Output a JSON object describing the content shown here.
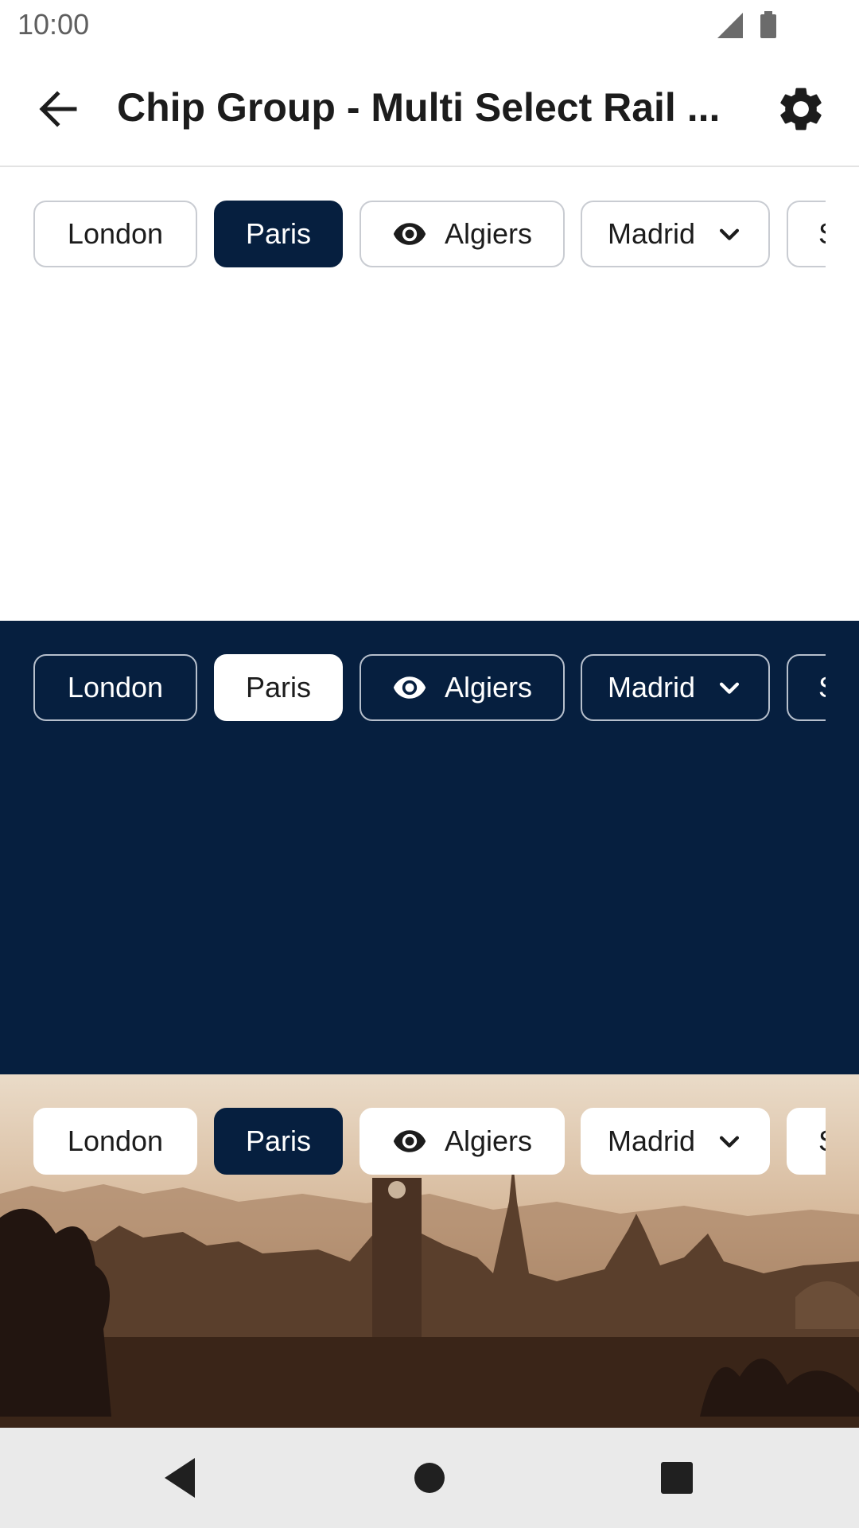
{
  "status_bar": {
    "time": "10:00",
    "icons": [
      "signal-icon",
      "battery-icon"
    ]
  },
  "app_bar": {
    "title": "Chip Group - Multi Select Rail ...",
    "back_icon": "arrow-back-icon",
    "settings_icon": "gear-icon"
  },
  "colors": {
    "brand_navy": "#061f3f",
    "chip_border": "#c9ccd2",
    "surface": "#ffffff",
    "nav_bar": "#e9e9e9"
  },
  "sections": [
    {
      "theme": "light",
      "chips": [
        {
          "label": "London",
          "selected": false
        },
        {
          "label": "Paris",
          "selected": true
        },
        {
          "label": "Algiers",
          "selected": false,
          "icon": "eye-icon"
        },
        {
          "label": "Madrid",
          "selected": false,
          "icon": "chevron-down-icon"
        },
        {
          "label": "S",
          "selected": false
        }
      ]
    },
    {
      "theme": "dark",
      "chips": [
        {
          "label": "London",
          "selected": false
        },
        {
          "label": "Paris",
          "selected": true
        },
        {
          "label": "Algiers",
          "selected": false,
          "icon": "eye-icon"
        },
        {
          "label": "Madrid",
          "selected": false,
          "icon": "chevron-down-icon"
        },
        {
          "label": "S",
          "selected": false
        }
      ]
    },
    {
      "theme": "image",
      "chips": [
        {
          "label": "London",
          "selected": false
        },
        {
          "label": "Paris",
          "selected": true
        },
        {
          "label": "Algiers",
          "selected": false,
          "icon": "eye-icon"
        },
        {
          "label": "Madrid",
          "selected": false,
          "icon": "chevron-down-icon"
        },
        {
          "label": "S",
          "selected": false
        }
      ]
    }
  ],
  "nav_bar": {
    "icons": [
      "nav-back-icon",
      "nav-home-icon",
      "nav-recents-icon"
    ]
  }
}
